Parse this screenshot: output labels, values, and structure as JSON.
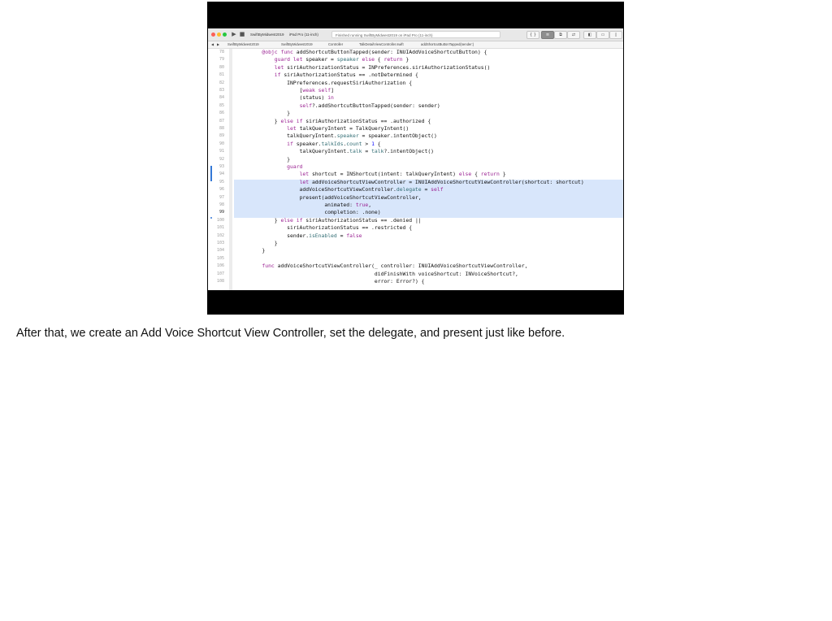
{
  "toolbar": {
    "scheme": "SwiftByMidwest2019",
    "destination": "iPad Pro (11-inch)",
    "status": "Finished running SwiftByMidwest2019 on iPad Pro (11-inch)",
    "play_glyph": "▶",
    "stop_glyph": "■",
    "right_buttons": [
      "{ }",
      "≡",
      "⧉",
      "⇄",
      "◧",
      "▭",
      "▯"
    ]
  },
  "jumpbar": {
    "items": [
      "SwiftByMidwest2019",
      "SwiftByMidwest2019",
      "Controller",
      "TalkDetailViewController.swift",
      "addShortcutButtonTapped(sender:)"
    ]
  },
  "code": {
    "current_line": 99,
    "lines": [
      {
        "n": 78,
        "tokens": [
          [
            "    ",
            ""
          ],
          [
            "@objc ",
            "kw"
          ],
          [
            "func ",
            "kw"
          ],
          [
            "addShortcutButtonTapped(sender: ",
            ""
          ],
          [
            "INUIAddVoiceShortcutButton",
            ""
          ],
          [
            ") {",
            ""
          ]
        ]
      },
      {
        "n": 79,
        "tokens": [
          [
            "        ",
            ""
          ],
          [
            "guard ",
            "kw"
          ],
          [
            "let ",
            "kw"
          ],
          [
            "speaker = ",
            ""
          ],
          [
            "speaker ",
            "pr"
          ],
          [
            "else ",
            "kw"
          ],
          [
            "{ ",
            ""
          ],
          [
            "return ",
            "kw"
          ],
          [
            "}",
            ""
          ]
        ]
      },
      {
        "n": 80,
        "tokens": [
          [
            "        ",
            ""
          ],
          [
            "let ",
            "kw"
          ],
          [
            "siriAuthorizationStatus = ",
            ""
          ],
          [
            "INPreferences",
            ""
          ],
          [
            ".",
            ""
          ],
          [
            "siriAuthorizationStatus",
            ""
          ],
          [
            "()",
            ""
          ]
        ]
      },
      {
        "n": 81,
        "tokens": [
          [
            "        ",
            ""
          ],
          [
            "if ",
            "kw"
          ],
          [
            "siriAuthorizationStatus == .",
            ""
          ],
          [
            "notDetermined",
            ""
          ],
          [
            " {",
            ""
          ]
        ]
      },
      {
        "n": 82,
        "tokens": [
          [
            "            ",
            ""
          ],
          [
            "INPreferences",
            ""
          ],
          [
            ".",
            ""
          ],
          [
            "requestSiriAuthorization",
            ""
          ],
          [
            " {",
            ""
          ]
        ]
      },
      {
        "n": 83,
        "tokens": [
          [
            "                [",
            ""
          ],
          [
            "weak ",
            "kw"
          ],
          [
            "self",
            "kw"
          ],
          [
            "]",
            ""
          ]
        ]
      },
      {
        "n": 84,
        "tokens": [
          [
            "                (status) ",
            ""
          ],
          [
            "in",
            "kw"
          ]
        ]
      },
      {
        "n": 85,
        "tokens": [
          [
            "                ",
            ""
          ],
          [
            "self",
            "kw"
          ],
          [
            "?.addShortcutButtonTapped(sender: sender)",
            ""
          ]
        ]
      },
      {
        "n": 86,
        "tokens": [
          [
            "            }",
            ""
          ]
        ]
      },
      {
        "n": 87,
        "tokens": [
          [
            "        } ",
            ""
          ],
          [
            "else ",
            "kw"
          ],
          [
            "if ",
            "kw"
          ],
          [
            "siriAuthorizationStatus == .",
            ""
          ],
          [
            "authorized",
            ""
          ],
          [
            " {",
            ""
          ]
        ]
      },
      {
        "n": 88,
        "tokens": [
          [
            "            ",
            ""
          ],
          [
            "let ",
            "kw"
          ],
          [
            "talkQueryIntent = ",
            ""
          ],
          [
            "TalkQueryIntent",
            ""
          ],
          [
            "()",
            ""
          ]
        ]
      },
      {
        "n": 89,
        "tokens": [
          [
            "            talkQueryIntent.",
            ""
          ],
          [
            "speaker",
            "pr"
          ],
          [
            " = speaker.",
            ""
          ],
          [
            "intentObject",
            ""
          ],
          [
            "()",
            ""
          ]
        ]
      },
      {
        "n": 90,
        "tokens": [
          [
            "            ",
            ""
          ],
          [
            "if ",
            "kw"
          ],
          [
            "speaker.",
            ""
          ],
          [
            "talkIds",
            "pr"
          ],
          [
            ".",
            ""
          ],
          [
            "count",
            "pr"
          ],
          [
            " > ",
            ""
          ],
          [
            "1",
            "fn"
          ],
          [
            " {",
            ""
          ]
        ]
      },
      {
        "n": 91,
        "tokens": [
          [
            "                talkQueryIntent.",
            ""
          ],
          [
            "talk",
            "pr"
          ],
          [
            " = ",
            ""
          ],
          [
            "talk",
            "pr"
          ],
          [
            "?.",
            ""
          ],
          [
            "intentObject",
            ""
          ],
          [
            "()",
            ""
          ]
        ]
      },
      {
        "n": 92,
        "tokens": [
          [
            "            }",
            ""
          ]
        ]
      },
      {
        "n": 93,
        "tokens": [
          [
            "            ",
            ""
          ],
          [
            "guard",
            "kw"
          ]
        ]
      },
      {
        "n": 94,
        "tokens": [
          [
            "                ",
            ""
          ],
          [
            "let ",
            "kw"
          ],
          [
            "shortcut = ",
            ""
          ],
          [
            "INShortcut",
            ""
          ],
          [
            "(intent: talkQueryIntent) ",
            ""
          ],
          [
            "else ",
            "kw"
          ],
          [
            "{ ",
            ""
          ],
          [
            "return ",
            "kw"
          ],
          [
            "}",
            ""
          ]
        ]
      },
      {
        "n": 95,
        "tokens": [
          [
            "                ",
            ""
          ],
          [
            "let ",
            "kw"
          ],
          [
            "addVoiceShortcutViewController = ",
            ""
          ],
          [
            "INUIAddVoiceShortcutViewController",
            ""
          ],
          [
            "(shortcut: shortcut)",
            ""
          ]
        ]
      },
      {
        "n": 96,
        "tokens": [
          [
            "                addVoiceShortcutViewController.",
            ""
          ],
          [
            "delegate",
            "pr"
          ],
          [
            " = ",
            ""
          ],
          [
            "self",
            "kw"
          ]
        ]
      },
      {
        "n": 97,
        "tokens": [
          [
            "                ",
            ""
          ],
          [
            "present",
            ""
          ],
          [
            "(addVoiceShortcutViewController,",
            ""
          ]
        ]
      },
      {
        "n": 98,
        "tokens": [
          [
            "                        animated: ",
            ""
          ],
          [
            "true",
            "kw"
          ],
          [
            ",",
            ""
          ]
        ]
      },
      {
        "n": 99,
        "tokens": [
          [
            "                        completion: .",
            ""
          ],
          [
            "none",
            ""
          ],
          [
            ")",
            ""
          ]
        ]
      },
      {
        "n": 100,
        "tokens": [
          [
            "        } ",
            ""
          ],
          [
            "else ",
            "kw"
          ],
          [
            "if ",
            "kw"
          ],
          [
            "siriAuthorizationStatus == .",
            ""
          ],
          [
            "denied",
            ""
          ],
          [
            " ||",
            ""
          ]
        ]
      },
      {
        "n": 101,
        "tokens": [
          [
            "            siriAuthorizationStatus == .",
            ""
          ],
          [
            "restricted",
            ""
          ],
          [
            " {",
            ""
          ]
        ]
      },
      {
        "n": 102,
        "tokens": [
          [
            "            sender.",
            ""
          ],
          [
            "isEnabled",
            "pr"
          ],
          [
            " = ",
            ""
          ],
          [
            "false",
            "kw"
          ]
        ]
      },
      {
        "n": 103,
        "tokens": [
          [
            "        }",
            ""
          ]
        ]
      },
      {
        "n": 104,
        "tokens": [
          [
            "    }",
            ""
          ]
        ]
      },
      {
        "n": 105,
        "tokens": [
          [
            "",
            ""
          ]
        ]
      },
      {
        "n": 106,
        "tokens": [
          [
            "    ",
            ""
          ],
          [
            "func ",
            "kw"
          ],
          [
            "addVoiceShortcutViewController(_ controller: ",
            ""
          ],
          [
            "INUIAddVoiceShortcutViewController",
            ""
          ],
          [
            ",",
            ""
          ]
        ]
      },
      {
        "n": 107,
        "tokens": [
          [
            "                                        didFinishWith voiceShortcut: ",
            ""
          ],
          [
            "INVoiceShortcut",
            ""
          ],
          [
            "?,",
            ""
          ]
        ]
      },
      {
        "n": 108,
        "tokens": [
          [
            "                                        error: ",
            ""
          ],
          [
            "Error",
            ""
          ],
          [
            "?) {",
            ""
          ]
        ]
      }
    ]
  },
  "caption": "After that, we create an Add Voice Shortcut View Controller, set the delegate, and present just like before."
}
